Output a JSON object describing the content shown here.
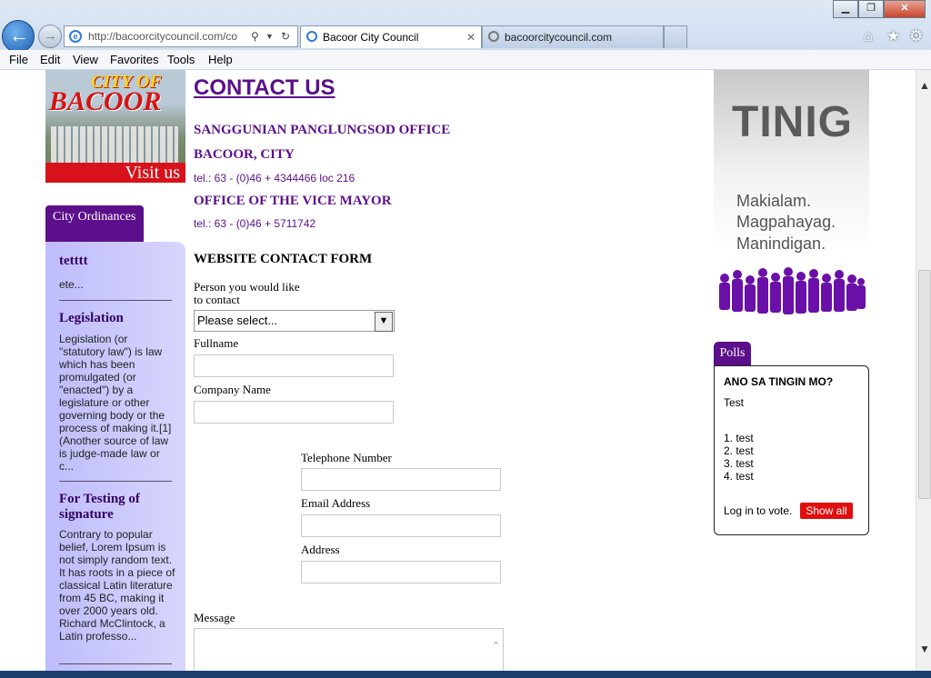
{
  "browser": {
    "address_url": "http://bacoorcitycouncil.com/co",
    "tabs": [
      {
        "label": "Bacoor City Council"
      },
      {
        "label": "bacoorcitycouncil.com"
      }
    ],
    "menu": [
      "File",
      "Edit",
      "View",
      "Favorites",
      "Tools",
      "Help"
    ]
  },
  "logo": {
    "line1": "CITY OF",
    "line2": "BACOOR",
    "visit": "Visit us"
  },
  "ordinances": {
    "tab_label": "City Ordinances",
    "items": [
      {
        "title": "tetttt",
        "summary": "ete..."
      },
      {
        "title": "Legislation",
        "summary": "Legislation (or \"statutory law\") is law which has been promulgated (or \"enacted\") by a legislature or other governing body or the process of making it.[1] (Another source of law is judge-made law or c..."
      },
      {
        "title": "For Testing of signature",
        "summary": "Contrary to popular belief, Lorem Ipsum is not simply random text. It has roots in a piece of classical Latin literature from 45 BC, making it over 2000 years old. Richard McClintock, a Latin professo..."
      }
    ]
  },
  "contact": {
    "title": "CONTACT US",
    "office1": "SANGGUNIAN PANGLUNGSOD OFFICE",
    "city": "BACOOR, CITY",
    "tel1": "tel.: 63 - (0)46 + 4344466 loc 216",
    "office2": "OFFICE OF THE VICE MAYOR",
    "tel2": "tel.: 63 - (0)46 + 5711742"
  },
  "form": {
    "title": "WEBSITE CONTACT FORM",
    "person_label_1": "Person you would like",
    "person_label_2": "to contact",
    "select_value": "Please select...",
    "fullname_label": "Fullname",
    "company_label": "Company Name",
    "telephone_label": "Telephone Number",
    "email_label": "Email Address",
    "address_label": "Address",
    "message_label": "Message"
  },
  "tinig": {
    "title": "TINIG",
    "line1": "Makialam.",
    "line2": "Magpahayag.",
    "line3": "Manindigan."
  },
  "polls": {
    "tab_label": "Polls",
    "question": "ANO SA TINGIN MO?",
    "description": "Test",
    "options": [
      "1. test",
      "2. test",
      "3. test",
      "4. test"
    ],
    "login_text": "Log in to vote.",
    "show_all": "Show all"
  }
}
